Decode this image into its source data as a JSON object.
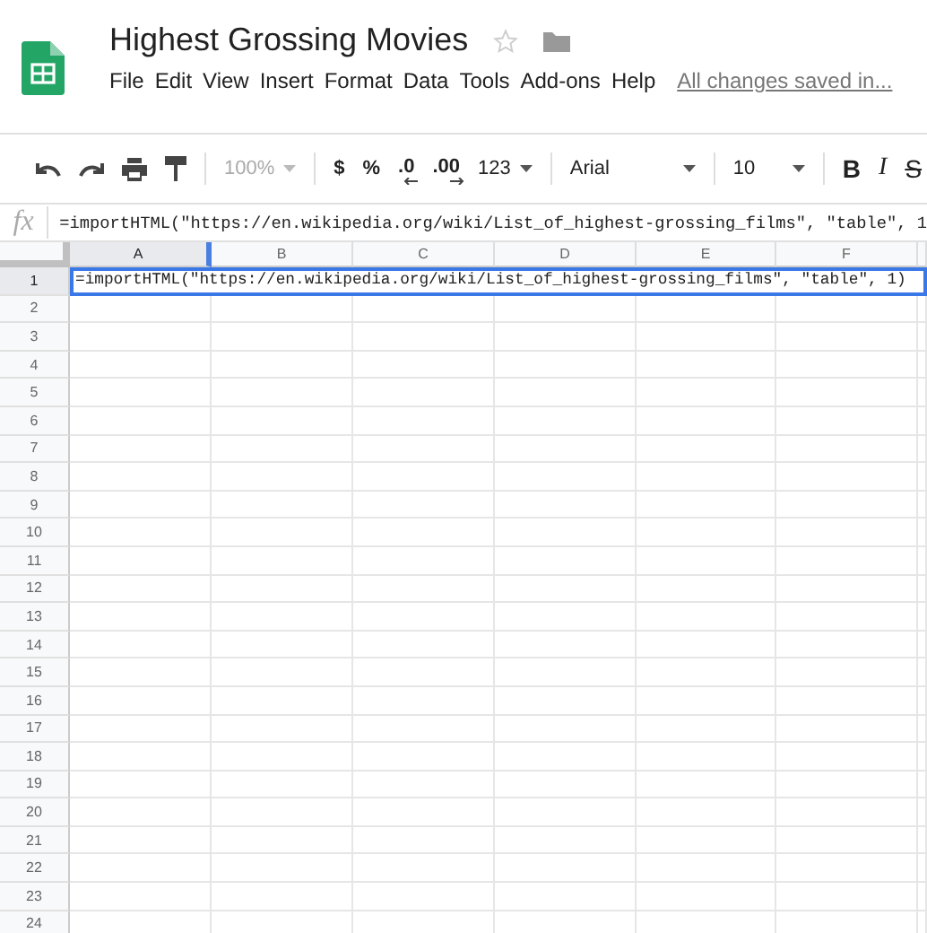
{
  "document": {
    "title": "Highest Grossing Movies",
    "save_status": "All changes saved in..."
  },
  "menu": [
    "File",
    "Edit",
    "View",
    "Insert",
    "Format",
    "Data",
    "Tools",
    "Add-ons",
    "Help"
  ],
  "toolbar": {
    "zoom": "100%",
    "currency": "$",
    "percent": "%",
    "decrease_decimals": ".0",
    "increase_decimals": ".00",
    "number_format": "123",
    "font": "Arial",
    "font_size": "10",
    "bold": "B",
    "italic": "I",
    "strikethrough": "S"
  },
  "formula_bar": {
    "label": "fx",
    "value": "=importHTML(\"https://en.wikipedia.org/wiki/List_of_highest-grossing_films\", \"table\", 1"
  },
  "columns": [
    {
      "label": "A",
      "selected": true
    },
    {
      "label": "B",
      "selected": false
    },
    {
      "label": "C",
      "selected": false
    },
    {
      "label": "D",
      "selected": false
    },
    {
      "label": "E",
      "selected": false
    },
    {
      "label": "F",
      "selected": false
    }
  ],
  "rows": [
    {
      "label": "1",
      "selected": true,
      "value": "=importHTML(\"https://en.wikipedia.org/wiki/List_of_highest-grossing_films\", \"table\", 1)"
    },
    {
      "label": "2",
      "selected": false
    },
    {
      "label": "3",
      "selected": false
    },
    {
      "label": "4",
      "selected": false
    },
    {
      "label": "5",
      "selected": false
    },
    {
      "label": "6",
      "selected": false
    },
    {
      "label": "7",
      "selected": false
    },
    {
      "label": "8",
      "selected": false
    },
    {
      "label": "9",
      "selected": false
    },
    {
      "label": "10",
      "selected": false
    },
    {
      "label": "11",
      "selected": false
    },
    {
      "label": "12",
      "selected": false
    },
    {
      "label": "13",
      "selected": false
    },
    {
      "label": "14",
      "selected": false
    },
    {
      "label": "15",
      "selected": false
    },
    {
      "label": "16",
      "selected": false
    },
    {
      "label": "17",
      "selected": false
    },
    {
      "label": "18",
      "selected": false
    },
    {
      "label": "19",
      "selected": false
    },
    {
      "label": "20",
      "selected": false
    },
    {
      "label": "21",
      "selected": false
    },
    {
      "label": "22",
      "selected": false
    },
    {
      "label": "23",
      "selected": false
    },
    {
      "label": "24",
      "selected": false
    }
  ]
}
